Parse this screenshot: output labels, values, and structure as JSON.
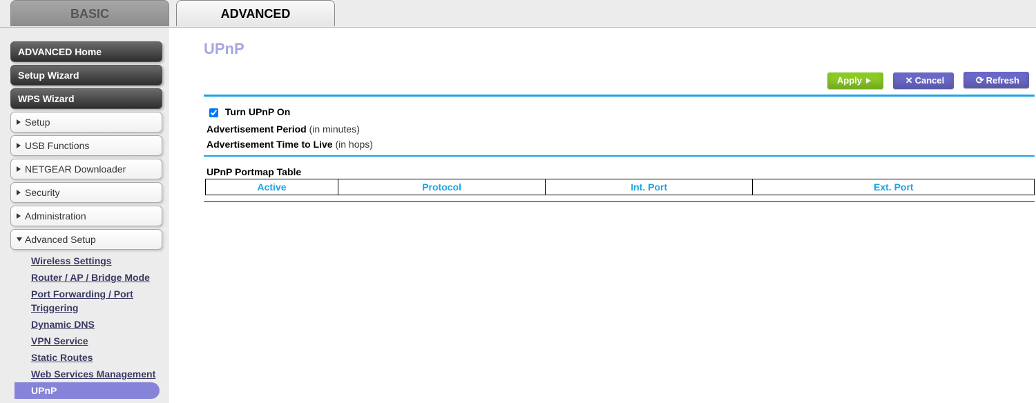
{
  "tabs": {
    "basic": "BASIC",
    "advanced": "ADVANCED"
  },
  "sidebar": {
    "primary": [
      {
        "label": "ADVANCED Home"
      },
      {
        "label": "Setup Wizard"
      },
      {
        "label": "WPS Wizard"
      }
    ],
    "nodes": [
      {
        "label": "Setup"
      },
      {
        "label": "USB Functions"
      },
      {
        "label": "NETGEAR Downloader"
      },
      {
        "label": "Security"
      },
      {
        "label": "Administration"
      },
      {
        "label": "Advanced Setup"
      }
    ],
    "advanced_setup_items": [
      "Wireless Settings",
      "Router / AP / Bridge Mode",
      "Port Forwarding / Port Triggering",
      "Dynamic DNS",
      "VPN Service",
      "Static Routes",
      "Web Services Management",
      "UPnP"
    ]
  },
  "page": {
    "title": "UPnP",
    "buttons": {
      "apply": "Apply",
      "cancel": "Cancel",
      "refresh": "Refresh"
    },
    "upnp_on_label": "Turn UPnP On",
    "upnp_on_checked": true,
    "adv_period_label": "Advertisement Period",
    "adv_period_hint": "(in minutes)",
    "adv_ttl_label": "Advertisement Time to Live",
    "adv_ttl_hint": "(in hops)",
    "table_title": "UPnP Portmap Table",
    "table_headers": {
      "active": "Active",
      "protocol": "Protocol",
      "intport": "Int. Port",
      "extport": "Ext. Port"
    }
  }
}
